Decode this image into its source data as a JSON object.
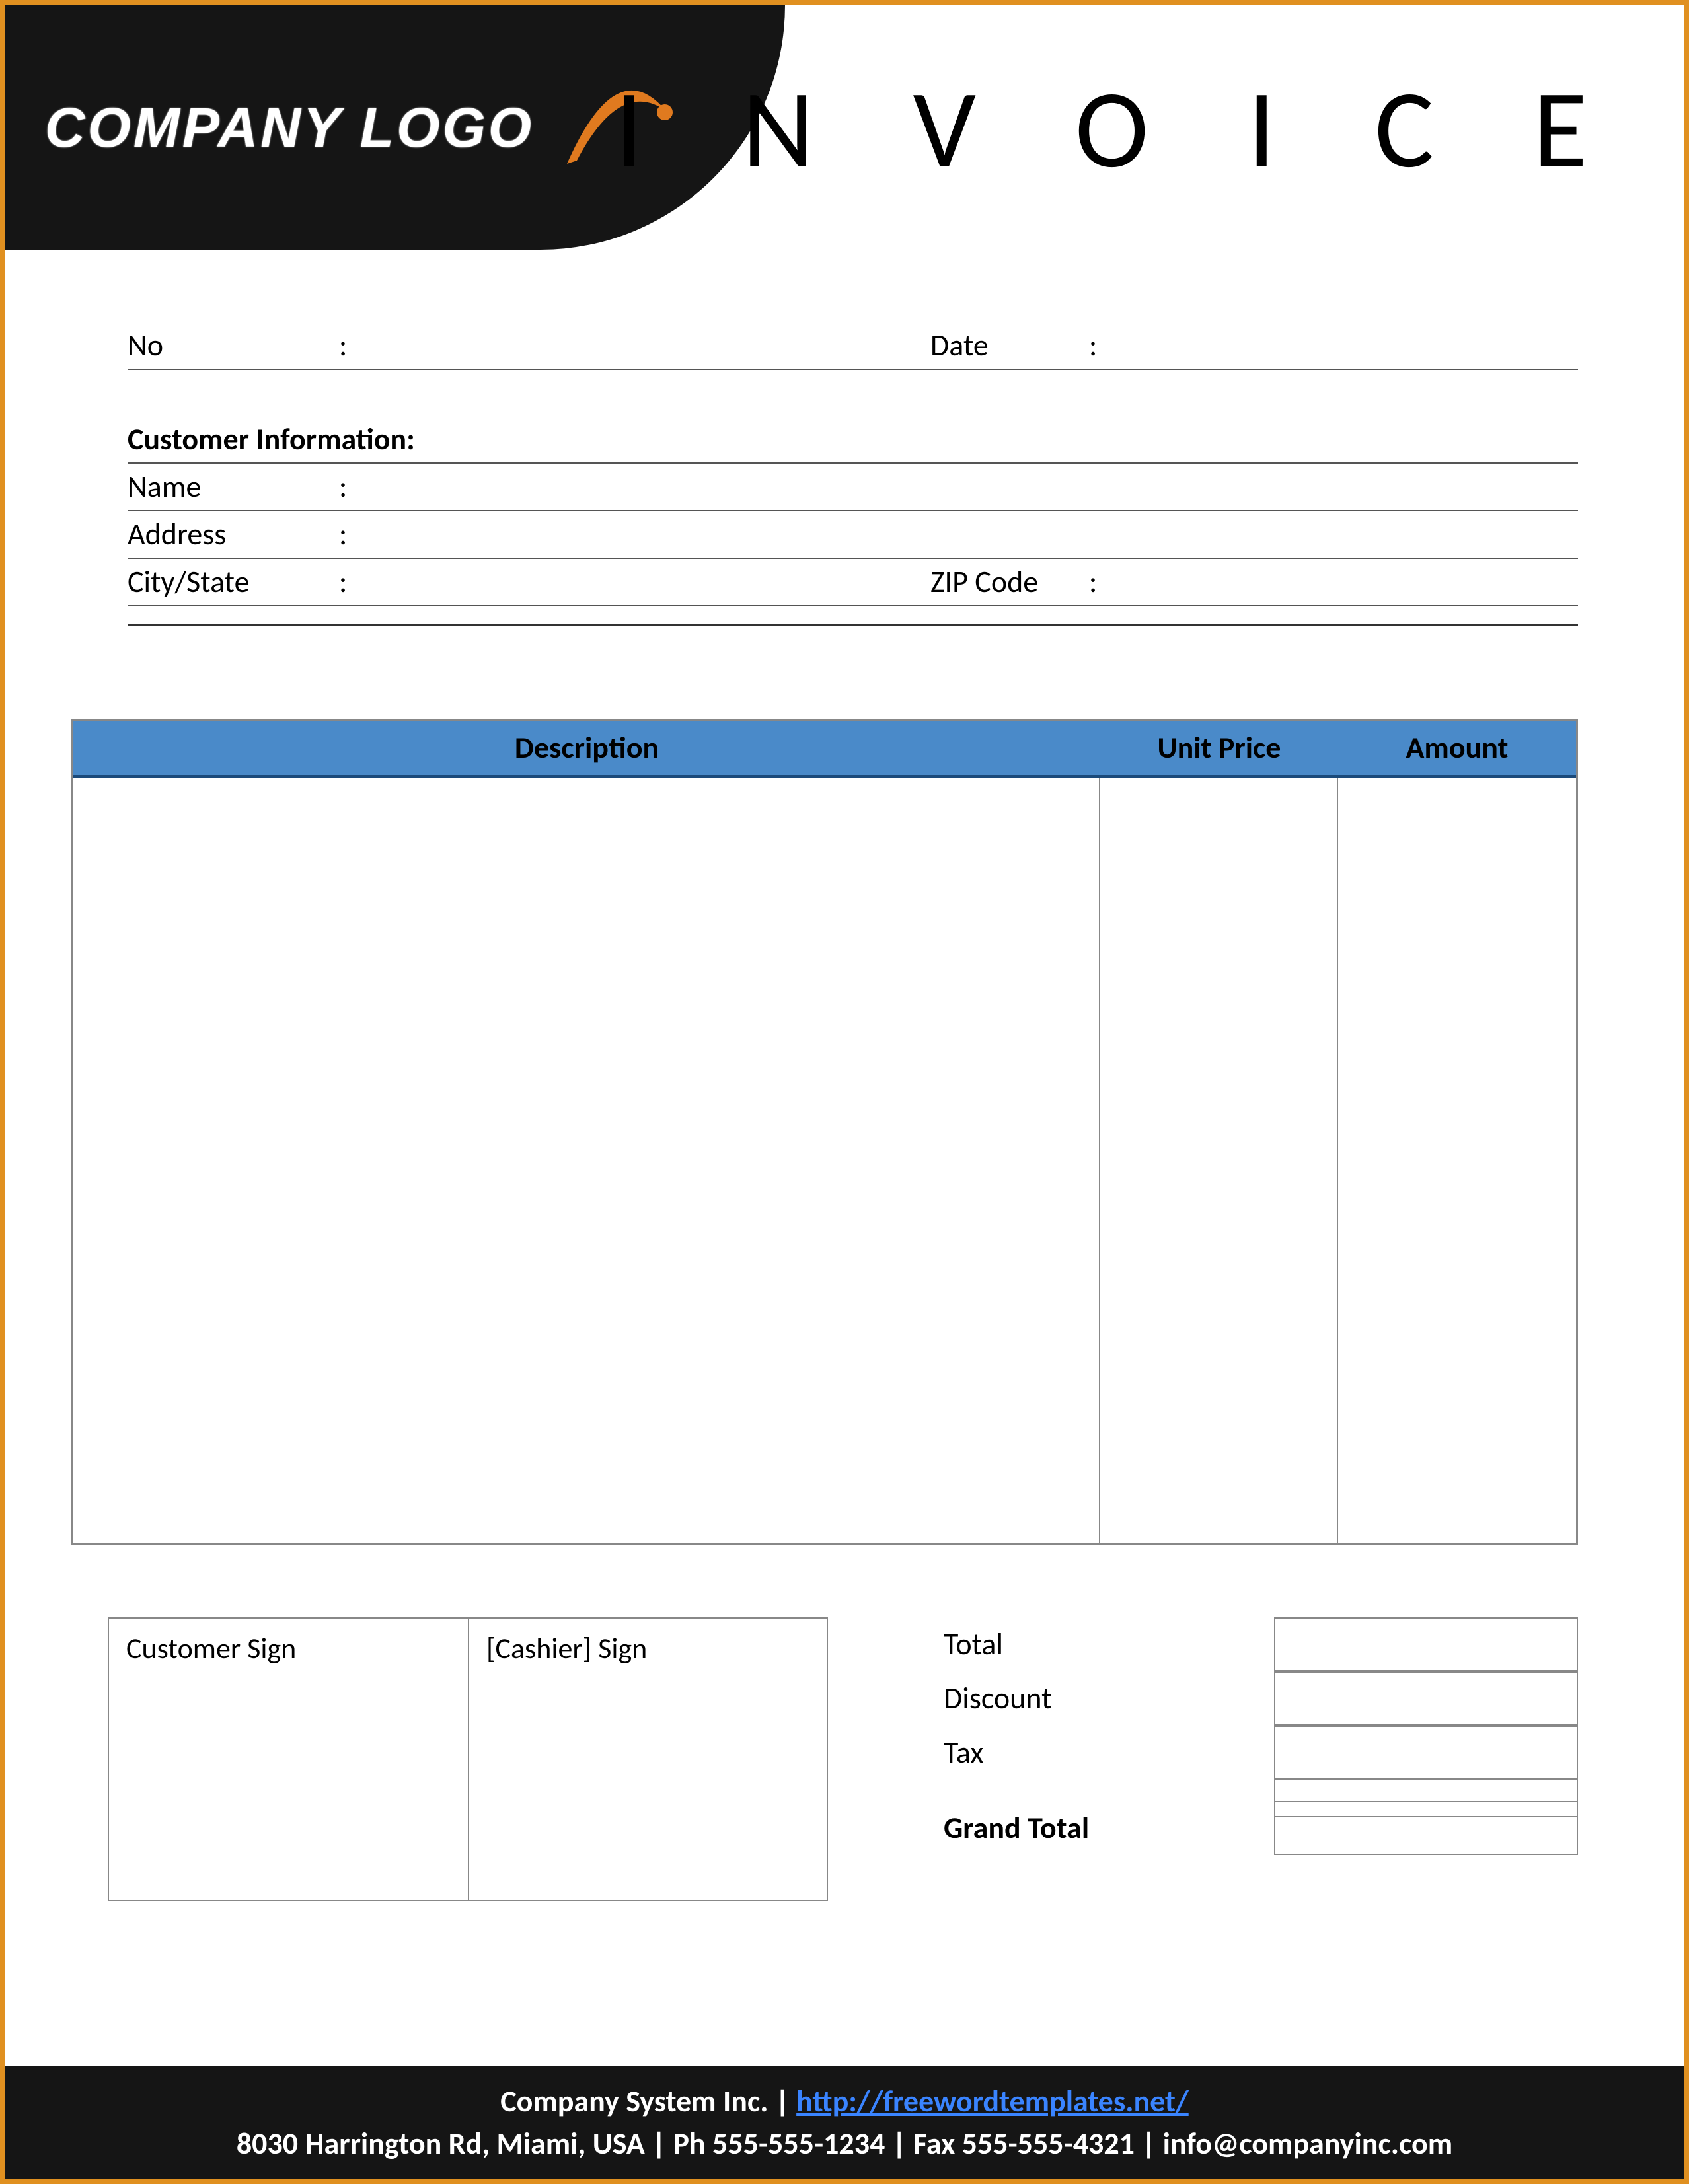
{
  "header": {
    "logo_text": "COMPANY LOGO",
    "title": "I N V O I C E"
  },
  "fields": {
    "no_label": "No",
    "date_label": "Date",
    "customer_info_heading": "Customer Information:",
    "name_label": "Name",
    "address_label": "Address",
    "city_state_label": "City/State",
    "zip_label": "ZIP Code",
    "colon": ":"
  },
  "table": {
    "col_description": "Description",
    "col_unit_price": "Unit Price",
    "col_amount": "Amount"
  },
  "signatures": {
    "customer": "Customer Sign",
    "cashier": "[Cashier] Sign"
  },
  "totals": {
    "total": "Total",
    "discount": "Discount",
    "tax": "Tax",
    "grand_total": "Grand Total"
  },
  "footer": {
    "company": "Company System Inc.",
    "sep": " | ",
    "url": "http://freewordtemplates.net/",
    "address_line": "8030 Harrington Rd, Miami, USA | Ph 555-555-1234 | Fax 555-555-4321 | info@companyinc.com"
  }
}
